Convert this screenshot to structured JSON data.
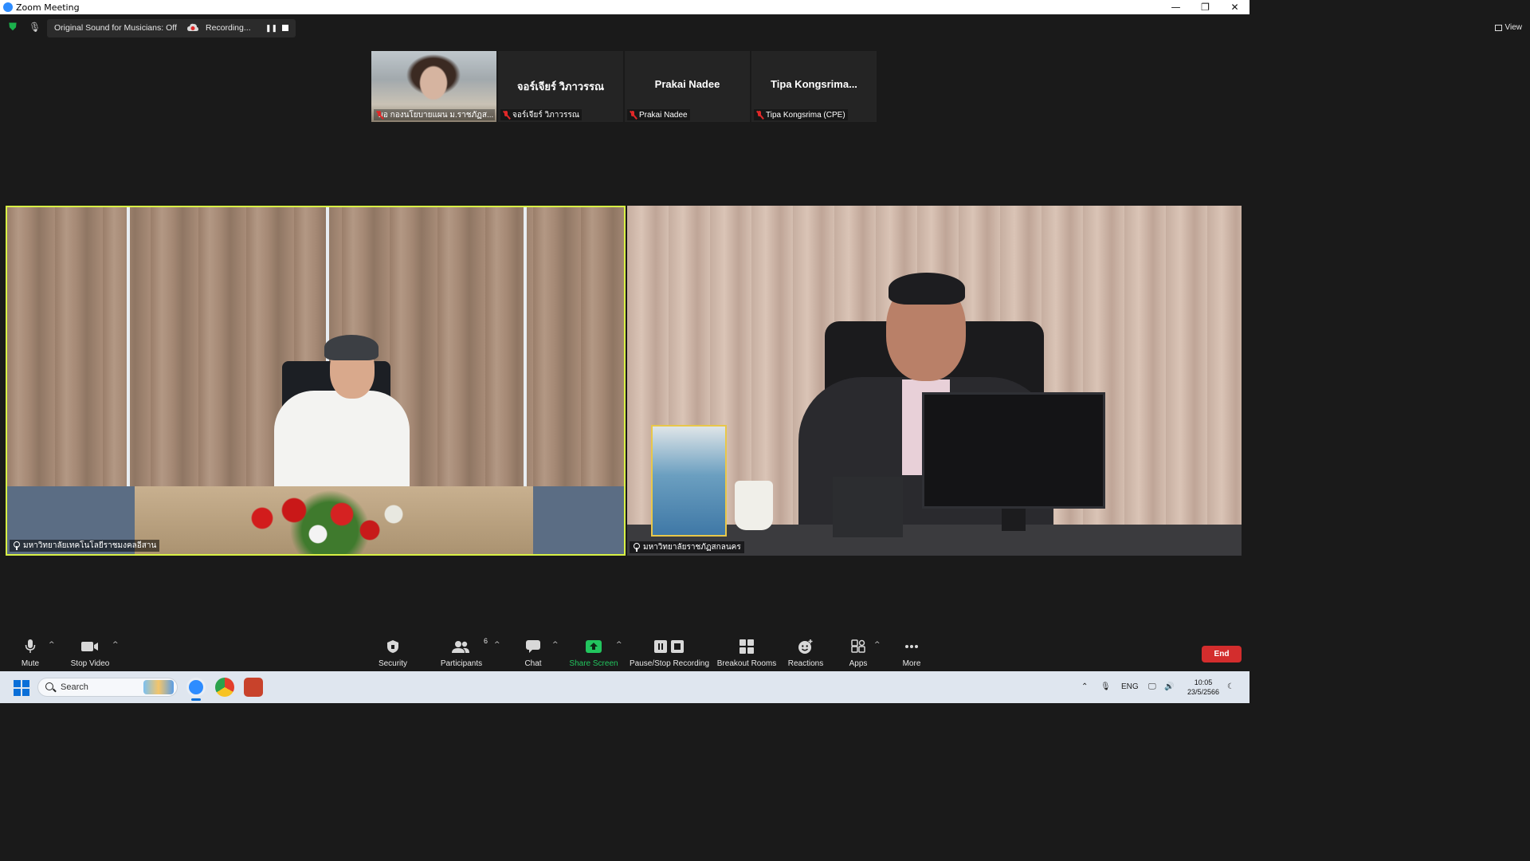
{
  "window": {
    "title": "Zoom Meeting"
  },
  "status_bar": {
    "original_sound": "Original Sound for Musicians: Off",
    "recording_label": "Recording...",
    "view_label": "View"
  },
  "participants_strip": [
    {
      "label": "ผอ กองนโยบายแผน ม.ราชภัฏส...",
      "has_video": true,
      "muted": true
    },
    {
      "display_name": "จอร์เจียร์ วิภาวรรณ",
      "label": "จอร์เจียร์ วิภาวรรณ",
      "has_video": false,
      "muted": true
    },
    {
      "display_name": "Prakai Nadee",
      "label": "Prakai Nadee",
      "has_video": false,
      "muted": true
    },
    {
      "display_name": "Tipa  Kongsrima...",
      "label": "Tipa Kongsrima (CPE)",
      "has_video": false,
      "muted": true
    }
  ],
  "main_videos": [
    {
      "label": "มหาวิทยาลัยเทคโนโลยีราชมงคลอีสาน",
      "active_speaker": true,
      "pinned": true
    },
    {
      "label": "มหาวิทยาลัยราชภัฏสกลนคร",
      "active_speaker": false,
      "pinned": true
    }
  ],
  "toolbar": {
    "mute": "Mute",
    "stop_video": "Stop Video",
    "security": "Security",
    "participants": "Participants",
    "participants_count": "6",
    "chat": "Chat",
    "share_screen": "Share Screen",
    "pause_stop_recording": "Pause/Stop Recording",
    "breakout_rooms": "Breakout Rooms",
    "reactions": "Reactions",
    "apps": "Apps",
    "more": "More",
    "end": "End",
    "share_color": "#22c55e",
    "end_color": "#d32d2d"
  },
  "taskbar": {
    "search_label": "Search",
    "language": "ENG",
    "time": "10:05",
    "date": "23/5/2566"
  }
}
